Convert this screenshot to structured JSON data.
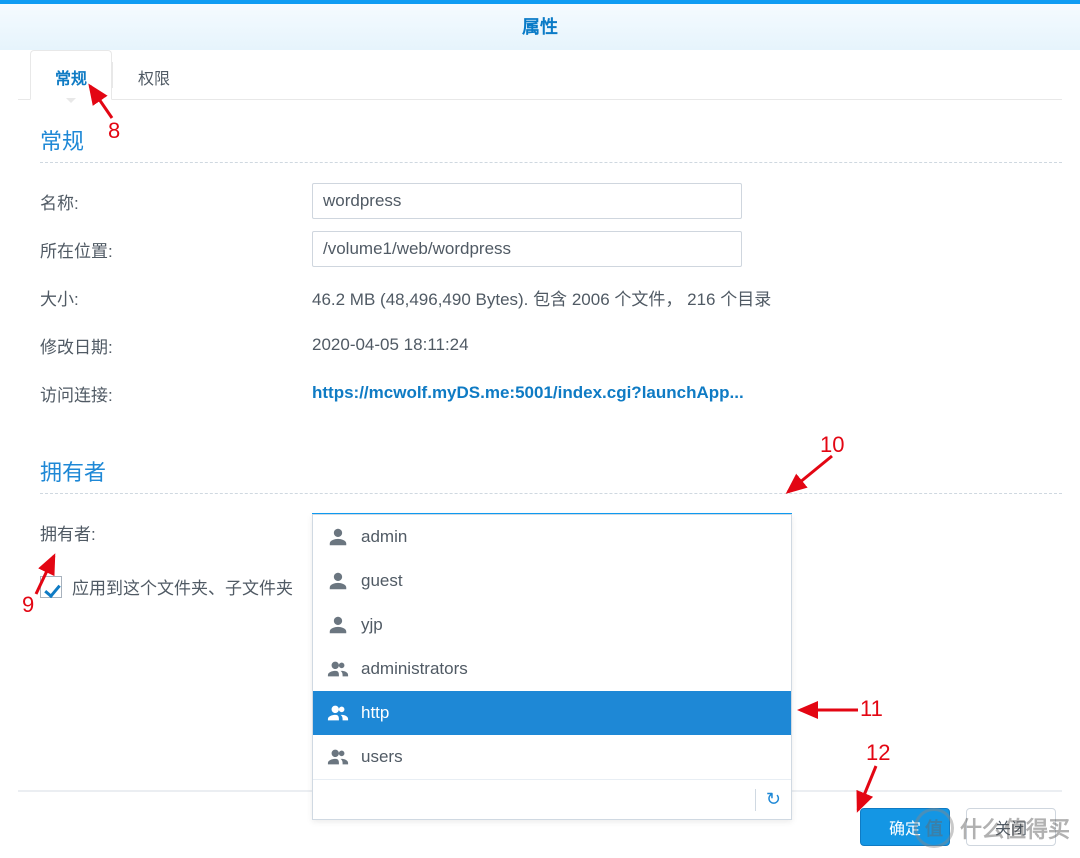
{
  "window": {
    "title": "属性"
  },
  "tabs": {
    "general": "常规",
    "permissions": "权限"
  },
  "sections": {
    "general_title": "常规",
    "owner_title": "拥有者"
  },
  "fields": {
    "name_label": "名称:",
    "name_value": "wordpress",
    "location_label": "所在位置:",
    "location_value": "/volume1/web/wordpress",
    "size_label": "大小:",
    "size_value": "46.2 MB (48,496,490 Bytes). 包含 2006 个文件， 216 个目录",
    "modified_label": "修改日期:",
    "modified_value": "2020-04-05 18:11:24",
    "link_label": "访问连接:",
    "link_value": "https://mcwolf.myDS.me:5001/index.cgi?launchApp..."
  },
  "owner": {
    "label": "拥有者:",
    "selected": "http",
    "apply_label": "应用到这个文件夹、子文件夹",
    "options": [
      {
        "name": "admin",
        "type": "user"
      },
      {
        "name": "guest",
        "type": "user"
      },
      {
        "name": "yjp",
        "type": "user"
      },
      {
        "name": "administrators",
        "type": "group"
      },
      {
        "name": "http",
        "type": "group",
        "selected": true
      },
      {
        "name": "users",
        "type": "group"
      }
    ]
  },
  "buttons": {
    "ok": "确定",
    "cancel": "关闭"
  },
  "watermark": {
    "mark": "值",
    "text": "什么值得买"
  },
  "annotations": {
    "a8": "8",
    "a9": "9",
    "a10": "10",
    "a11": "11",
    "a12": "12"
  }
}
